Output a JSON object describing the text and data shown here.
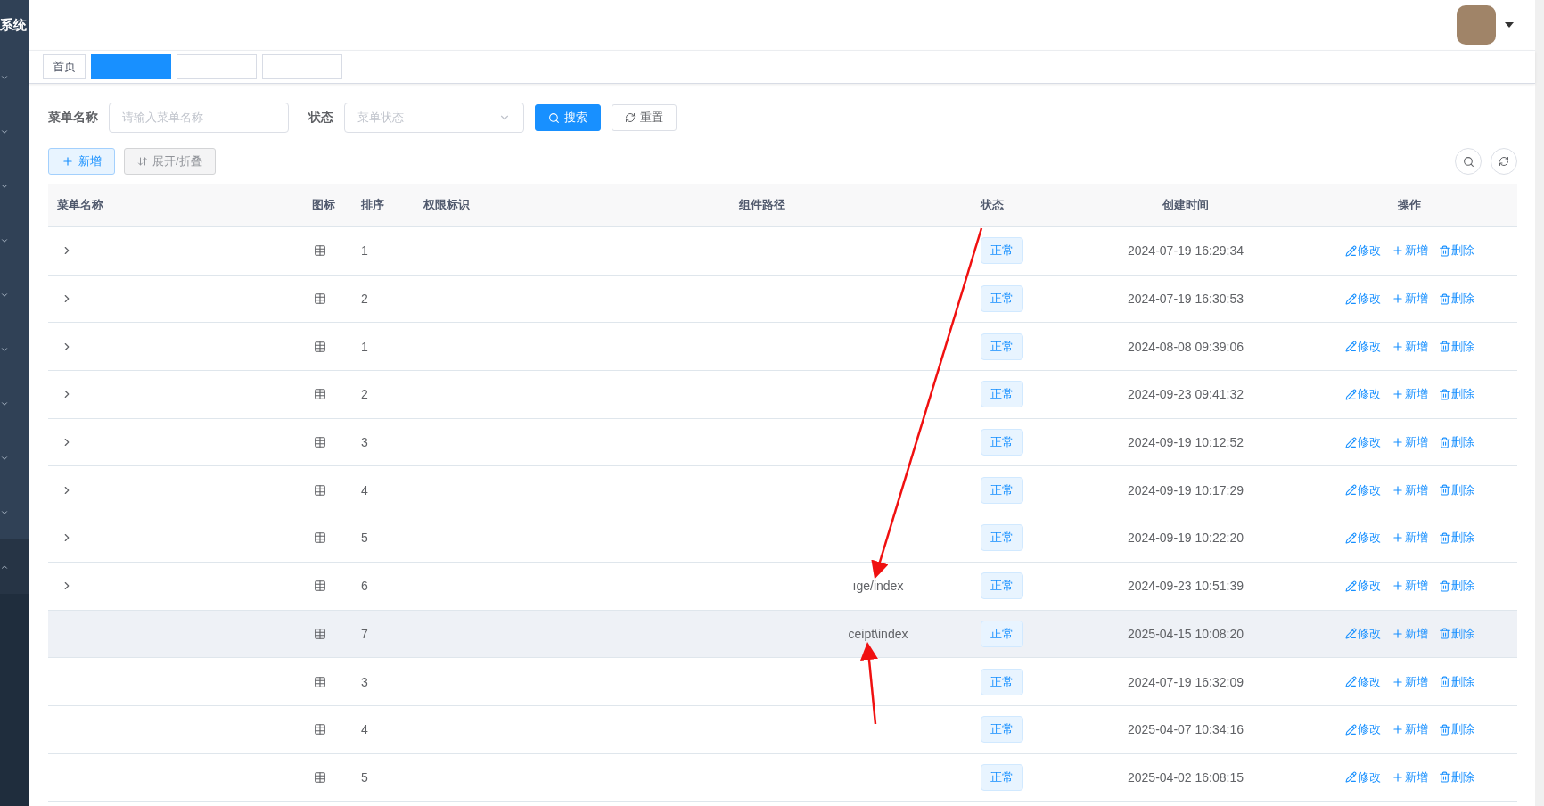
{
  "sidebar": {
    "title": "系统",
    "items": [
      {
        "expanded": false
      },
      {
        "expanded": false
      },
      {
        "expanded": false
      },
      {
        "expanded": false
      },
      {
        "expanded": false
      },
      {
        "expanded": false
      },
      {
        "expanded": false
      },
      {
        "expanded": false
      },
      {
        "expanded": false
      },
      {
        "expanded": true
      }
    ]
  },
  "tabs": [
    {
      "label": "首页",
      "selected": false
    },
    {
      "selected": true
    },
    {
      "selected": false
    },
    {
      "selected": false
    }
  ],
  "filters": [
    {
      "kind": "input",
      "label": "菜单名称",
      "placeholder": "请输入菜单名称"
    },
    {
      "kind": "select",
      "label": "状态",
      "placeholder": "菜单状态"
    }
  ],
  "filter_buttons": [
    {
      "kind": "search",
      "label": "搜索"
    },
    {
      "kind": "reset",
      "label": "重置"
    }
  ],
  "toolbar": [
    {
      "kind": "add",
      "label": "新增"
    },
    {
      "kind": "toggle",
      "label": "展开/折叠"
    }
  ],
  "table": {
    "columns": [
      "菜单名称",
      "图标",
      "排序",
      "权限标识",
      "组件路径",
      "状态",
      "创建时间",
      "操作"
    ],
    "rows": [
      {
        "expandable": true,
        "highlighted": false,
        "order": "1",
        "status": "正常",
        "created": "2024-07-19 16:29:34",
        "actions": [
          {
            "kind": "edit",
            "label": "修改"
          },
          {
            "kind": "add",
            "label": "新增"
          },
          {
            "kind": "delete",
            "label": "删除"
          }
        ]
      },
      {
        "expandable": true,
        "highlighted": false,
        "order": "2",
        "status": "正常",
        "created": "2024-07-19 16:30:53",
        "actions": [
          {
            "kind": "edit",
            "label": "修改"
          },
          {
            "kind": "add",
            "label": "新增"
          },
          {
            "kind": "delete",
            "label": "删除"
          }
        ]
      },
      {
        "expandable": true,
        "highlighted": false,
        "order": "1",
        "status": "正常",
        "created": "2024-08-08 09:39:06",
        "actions": [
          {
            "kind": "edit",
            "label": "修改"
          },
          {
            "kind": "add",
            "label": "新增"
          },
          {
            "kind": "delete",
            "label": "删除"
          }
        ]
      },
      {
        "expandable": true,
        "highlighted": false,
        "order": "2",
        "status": "正常",
        "created": "2024-09-23 09:41:32",
        "actions": [
          {
            "kind": "edit",
            "label": "修改"
          },
          {
            "kind": "add",
            "label": "新增"
          },
          {
            "kind": "delete",
            "label": "删除"
          }
        ]
      },
      {
        "expandable": true,
        "highlighted": false,
        "order": "3",
        "status": "正常",
        "created": "2024-09-19 10:12:52",
        "actions": [
          {
            "kind": "edit",
            "label": "修改"
          },
          {
            "kind": "add",
            "label": "新增"
          },
          {
            "kind": "delete",
            "label": "删除"
          }
        ]
      },
      {
        "expandable": true,
        "highlighted": false,
        "order": "4",
        "status": "正常",
        "created": "2024-09-19 10:17:29",
        "actions": [
          {
            "kind": "edit",
            "label": "修改"
          },
          {
            "kind": "add",
            "label": "新增"
          },
          {
            "kind": "delete",
            "label": "删除"
          }
        ]
      },
      {
        "expandable": true,
        "highlighted": false,
        "order": "5",
        "status": "正常",
        "created": "2024-09-19 10:22:20",
        "actions": [
          {
            "kind": "edit",
            "label": "修改"
          },
          {
            "kind": "add",
            "label": "新增"
          },
          {
            "kind": "delete",
            "label": "删除"
          }
        ]
      },
      {
        "expandable": true,
        "highlighted": false,
        "order": "6",
        "component_path": "ıge/index",
        "status": "正常",
        "created": "2024-09-23 10:51:39",
        "actions": [
          {
            "kind": "edit",
            "label": "修改"
          },
          {
            "kind": "add",
            "label": "新增"
          },
          {
            "kind": "delete",
            "label": "删除"
          }
        ]
      },
      {
        "expandable": false,
        "highlighted": true,
        "order": "7",
        "component_path": "ceipt\\index",
        "status": "正常",
        "created": "2025-04-15 10:08:20",
        "actions": [
          {
            "kind": "edit",
            "label": "修改"
          },
          {
            "kind": "add",
            "label": "新增"
          },
          {
            "kind": "delete",
            "label": "删除"
          }
        ]
      },
      {
        "expandable": false,
        "highlighted": false,
        "order": "3",
        "status": "正常",
        "created": "2024-07-19 16:32:09",
        "actions": [
          {
            "kind": "edit",
            "label": "修改"
          },
          {
            "kind": "add",
            "label": "新增"
          },
          {
            "kind": "delete",
            "label": "删除"
          }
        ]
      },
      {
        "expandable": false,
        "highlighted": false,
        "order": "4",
        "status": "正常",
        "created": "2025-04-07 10:34:16",
        "actions": [
          {
            "kind": "edit",
            "label": "修改"
          },
          {
            "kind": "add",
            "label": "新增"
          },
          {
            "kind": "delete",
            "label": "删除"
          }
        ]
      },
      {
        "expandable": false,
        "highlighted": false,
        "order": "5",
        "status": "正常",
        "created": "2025-04-02 16:08:15",
        "actions": [
          {
            "kind": "edit",
            "label": "修改"
          },
          {
            "kind": "add",
            "label": "新增"
          },
          {
            "kind": "delete",
            "label": "删除"
          }
        ]
      }
    ]
  }
}
